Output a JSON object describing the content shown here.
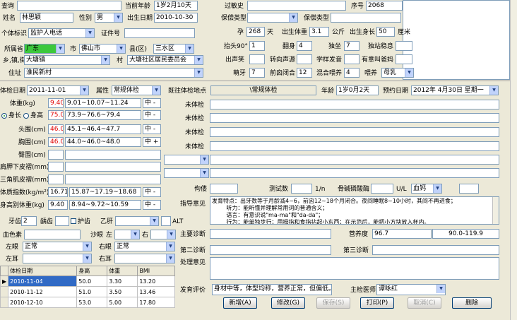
{
  "top": {
    "query_label": "查询",
    "age_label": "当前年龄",
    "age": "1岁2月10天",
    "allergy_label": "过敏史",
    "seq_label": "序号",
    "seq": "2068"
  },
  "child": {
    "name_label": "姓名",
    "name": "林思颖",
    "gender_label": "性别",
    "gender": "男",
    "birth_label": "出生日期",
    "birth": "2010-10-30",
    "insurance_label": "保偿类型",
    "bodytype_label": "体弱类型",
    "id_label": "个体标识",
    "id_type": "监护人电话",
    "cert_label": "证件号",
    "preg_label": "孕",
    "preg": "268",
    "preg_unit": "天",
    "bw_label": "出生体重",
    "bw": "3.1",
    "bw_unit": "公斤",
    "bl_label": "出生身长",
    "bl": "50",
    "bl_unit": "厘米",
    "prov_label": "所属省",
    "prov": "广东",
    "city_label": "市",
    "city": "佛山市",
    "county_label": "县(区)",
    "county": "三水区",
    "town_label": "乡,镇,街",
    "town": "大塘镇",
    "village_label": "村",
    "village": "大塘社区居民委员会",
    "addr_label": "住址",
    "addr": "淮民新村",
    "m": [
      {
        "l": "抬头90°",
        "v": "1"
      },
      {
        "l": "翻身",
        "v": "4"
      },
      {
        "l": "独坐",
        "v": "7"
      },
      {
        "l": "独站稳息",
        "v": ""
      },
      {
        "l": "出声笑",
        "v": ""
      },
      {
        "l": "转向声源",
        "v": ""
      },
      {
        "l": "学样发音",
        "v": ""
      },
      {
        "l": "有意叫爸妈",
        "v": ""
      },
      {
        "l": "萌牙",
        "v": "7"
      },
      {
        "l": "前囟闭合",
        "v": "12"
      },
      {
        "l": "混合喂养",
        "v": "4"
      },
      {
        "l": "喂养",
        "v": "母乳"
      }
    ]
  },
  "exam": {
    "date_label": "体检日期",
    "date": "2011-11-01",
    "prop_label": "属性",
    "prop": "常规体检",
    "prev_label": "既往体检地点",
    "prev": "\\常规体检",
    "age_label": "年龄",
    "age": "1岁0月2天",
    "appt_label": "预约日期",
    "appt": "2012年 4月30日 星期一",
    "wt_label": "体重(kg)",
    "wt": "9.40",
    "wt_ref": "9.01~10.07~11.24",
    "wt_eval": "中 -",
    "len_label": "身长",
    "ht_label": "身高",
    "len": "75.0",
    "len_ref": "73.9~76.6~79.4",
    "len_eval": "中 -",
    "head_label": "头围(cm)",
    "head": "46.0",
    "head_ref": "45.1~46.4~47.7",
    "head_eval": "中 -",
    "chest_label": "胸围(cm)",
    "chest": "46.0",
    "chest_ref": "44.0~46.0~48.0",
    "chest_eval": "中 +",
    "hip_label": "臀围(cm)",
    "scap_label": "肩胛下皮褶(mm)",
    "tri_label": "三角肌皮褶(mm)",
    "bmi_label": "体质指数(kg/m²)",
    "bmi": "16.71",
    "bmi_ref": "15.87~17.19~18.68",
    "bmi_eval": "中 -",
    "wfh_label": "身高别体重(kg)",
    "wfh": "9.40",
    "wfh_ref": "8.94~9.72~10.59",
    "wfh_eval": "中 -",
    "none": "未体检",
    "teeth_label": "牙齿",
    "teeth": "2",
    "caries_label": "龋齿",
    "care_label": "护齿",
    "hepb_label": "乙肝",
    "alt_label": "ALT",
    "hb_label": "血色素",
    "trachoma_label": "沙眼",
    "left_label": "左",
    "right_label": "右",
    "leye_label": "左眼",
    "leye": "正常",
    "reye_label": "右眼",
    "reye": "正常",
    "lear_label": "左耳",
    "rear_label": "右耳",
    "rickets_label": "佝偻",
    "calc_label": "测试数",
    "calc_unit": "1/n",
    "alp_label": "骨碱磷酸酶",
    "alp_unit": "U/L",
    "ca": "血钙",
    "guide_label": "指导意见",
    "guide": "发育特点：出牙数等于月龄减4~6，前囟12~18个月闭合。夜间睡眠8~10小时，其间不再进食；\n        听力：能听懂并理解常用词的普通含义；\n        语言：有意识说\"ma-ma\"和\"da-da\"；\n        行为：能单独步行；用拇指和食指拈起小东西；在示范后，能把小方块放入杯内。",
    "diag1_label": "主要诊断",
    "nutri_label": "营养度",
    "nutri": "96.7",
    "nutri_ref": "90.0-119.9",
    "diag2_label": "第二诊断",
    "diag3_label": "第三诊断",
    "treat_label": "处理意见",
    "dev_label": "发育评价",
    "dev": "身材中等，体型均称，营养正常，但偏低。",
    "doc_label": "主检医师",
    "doc": "谭咏红"
  },
  "history": {
    "headers": [
      "体检日期",
      "身高",
      "体重",
      "BMI"
    ],
    "rows": [
      [
        "2010-11-04",
        "50.0",
        "3.30",
        "13.20"
      ],
      [
        "2010-11-12",
        "51.0",
        "3.50",
        "13.46"
      ],
      [
        "2010-12-10",
        "53.0",
        "5.00",
        "17.80"
      ]
    ]
  },
  "buttons": {
    "add": "新增(A)",
    "edit": "修改(G)",
    "save": "保存(S)",
    "print": "打印(P)",
    "cancel": "取消(C)",
    "del": "删除"
  }
}
